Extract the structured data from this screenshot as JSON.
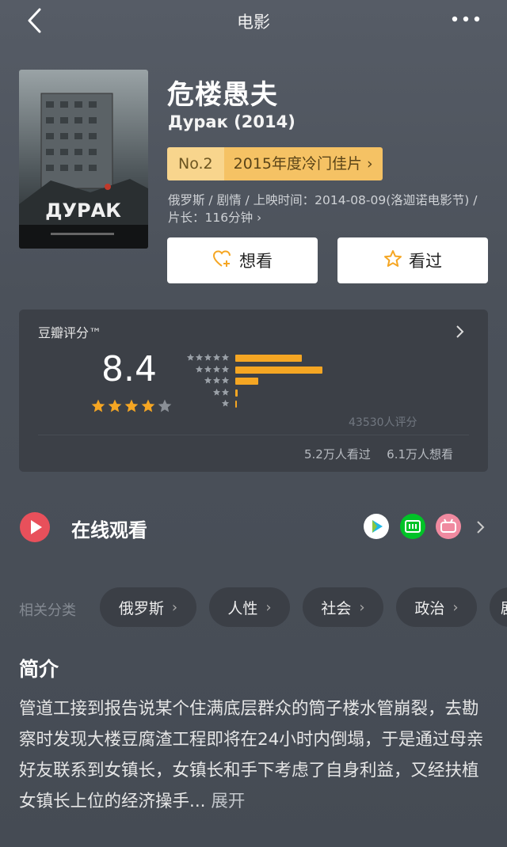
{
  "nav": {
    "title": "电影",
    "back_icon": "chevron-left-icon",
    "more_icon": "more-horizontal-icon"
  },
  "movie": {
    "title": "危楼愚夫",
    "original_title": "Дурак (2014)",
    "rank_no": "No.2",
    "rank_label": "2015年度冷门佳片",
    "meta": "俄罗斯 / 剧情 / 上映时间：2014-08-09(洛迦诺电影节) / 片长：116分钟",
    "poster_text": "ДУРАК"
  },
  "actions": {
    "want_label": "想看",
    "seen_label": "看过"
  },
  "rating": {
    "label": "豆瓣评分™",
    "score": "8.4",
    "stars": 4,
    "distribution_pct": [
      38.0,
      50.0,
      13.0,
      1.5,
      0.5
    ],
    "total_votes": "43530人评分",
    "watched": "5.2万人看过",
    "wanted": "6.1万人想看"
  },
  "online": {
    "title": "在线观看",
    "platforms": [
      "tencent-video-icon",
      "iqiyi-icon",
      "bilibili-icon"
    ]
  },
  "categories": {
    "label": "相关分类",
    "items": [
      "俄罗斯",
      "人性",
      "社会",
      "政治"
    ],
    "partial": "剧"
  },
  "intro": {
    "title": "简介",
    "text": "管道工接到报告说某个住满底层群众的筒子楼水管崩裂，去勘察时发现大楼豆腐渣工程即将在24小时内倒塌，于是通过母亲好友联系到女镇长，女镇长和手下考虑了自身利益，又经扶植女镇长上位的经济操手...",
    "expand": "展开"
  },
  "colors": {
    "accent": "#f5a623",
    "badge": "#f5c264",
    "play": "#e8505b"
  }
}
